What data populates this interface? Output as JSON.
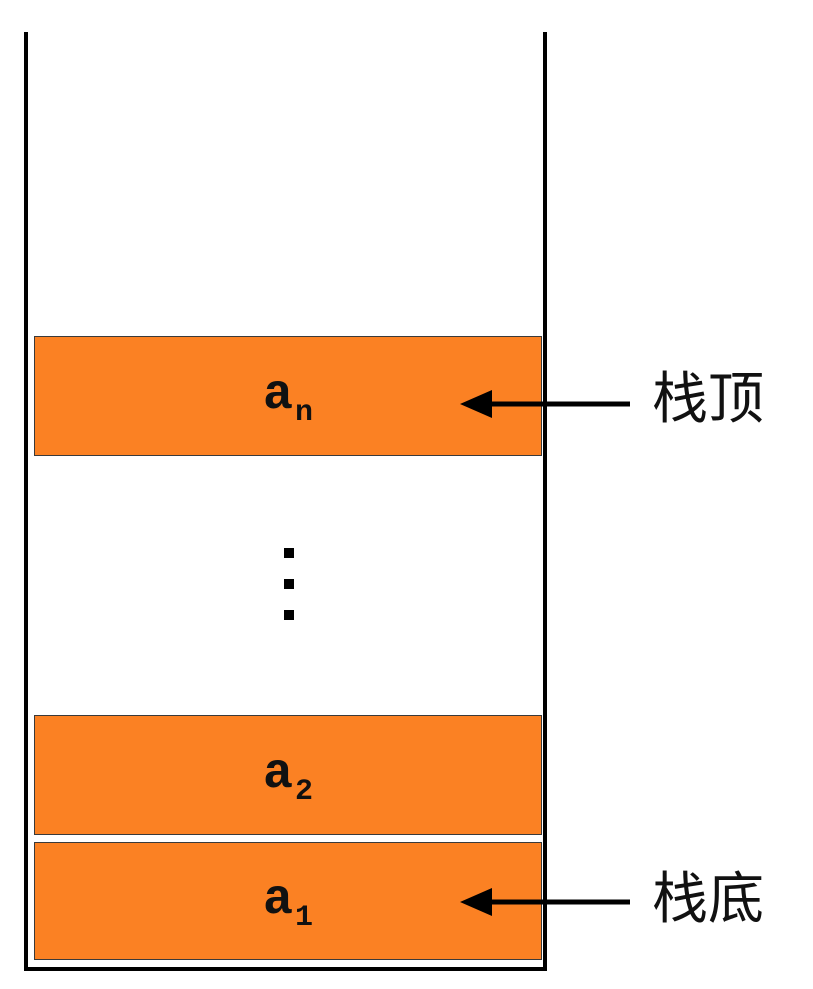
{
  "stack": {
    "top_element": {
      "base": "a",
      "subscript": "n"
    },
    "ellipsis": "⋮",
    "second_element": {
      "base": "a",
      "subscript": "2"
    },
    "bottom_element": {
      "base": "a",
      "subscript": "1"
    }
  },
  "pointers": {
    "top_label": "栈顶",
    "bottom_label": "栈底"
  },
  "colors": {
    "cell_fill": "#fb8123",
    "outline": "#000000"
  }
}
